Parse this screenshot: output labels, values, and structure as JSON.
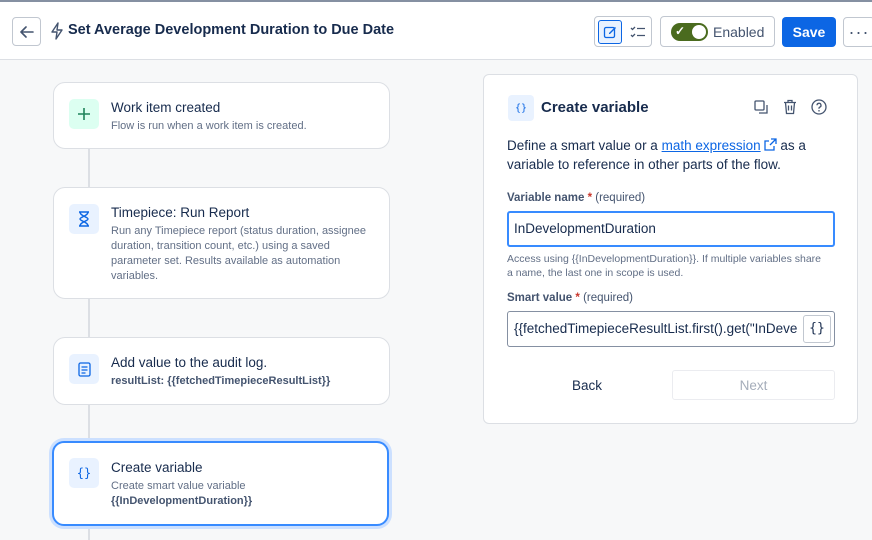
{
  "header": {
    "title": "Set Average Development Duration to Due Date",
    "enabled_label": "Enabled",
    "save_label": "Save",
    "more_label": "···"
  },
  "flow": {
    "cards": [
      {
        "title": "Work item created",
        "desc": "Flow is run when a work item is created.",
        "icon": "plus-icon"
      },
      {
        "title": "Timepiece: Run Report",
        "desc": "Run any Timepiece report (status duration, assignee duration, transition count, etc.) using a saved parameter set. Results available as automation variables.",
        "icon": "hourglass-icon"
      },
      {
        "title": "Add value to the audit log.",
        "desc": "resultList: {{fetchedTimepieceResultList}}",
        "icon": "document-icon"
      },
      {
        "title": "Create variable",
        "desc": "Create smart value variable",
        "desc2": "{{InDevelopmentDuration}}",
        "icon": "braces-icon"
      }
    ]
  },
  "panel": {
    "title": "Create variable",
    "icon_text": "{}",
    "desc_before": "Define a smart value or a ",
    "desc_link": "math expression",
    "desc_after": " as a variable to reference in other parts of the flow.",
    "var_label": "Variable name",
    "var_required": "(required)",
    "var_value": "InDevelopmentDuration",
    "helper": "Access using {{InDevelopmentDuration}}. If multiple variables share a name, the last one in scope is used.",
    "smart_label": "Smart value",
    "smart_required": "(required)",
    "smart_value": "{{fetchedTimepieceResultList.first().get(\"InDevelopment\")}}",
    "brace_label": "{}",
    "back_label": "Back",
    "next_label": "Next"
  },
  "colors": {
    "accent": "#0c66e4",
    "enabled_toggle": "#4a6b1e",
    "selected_border": "#388bff"
  }
}
